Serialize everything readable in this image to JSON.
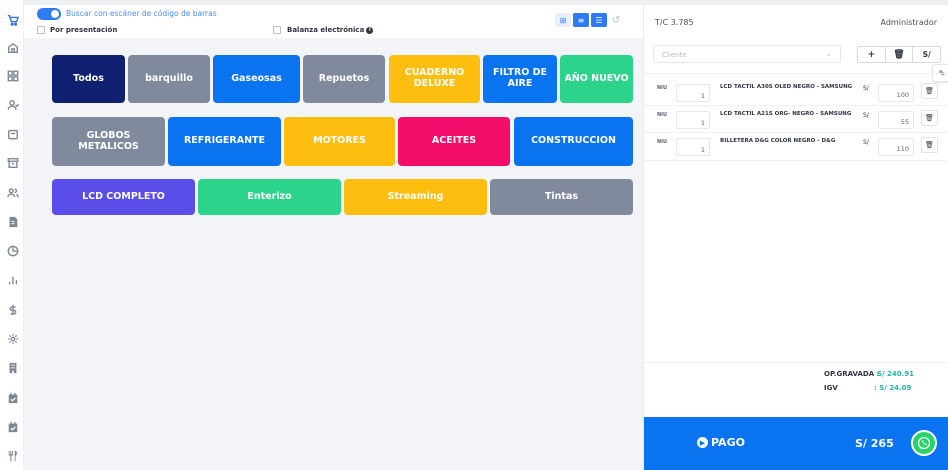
{
  "toolbar": {
    "scanner_label": "Buscar con escáner de código de barras",
    "presentation_label": "Por presentación",
    "scale_label": "Balanza electrónica"
  },
  "categories": [
    {
      "label": "Todos",
      "color": "#0f2070"
    },
    {
      "label": "barquillo",
      "color": "#808a9c"
    },
    {
      "label": "Gaseosas",
      "color": "#0a74f0"
    },
    {
      "label": "Repuetos",
      "color": "#808a9c"
    },
    {
      "label": "CUADERNO DELUXE",
      "color": "#fdbe10"
    },
    {
      "label": "FILTRO DE AIRE",
      "color": "#0a74f0"
    },
    {
      "label": "AÑO NUEVO",
      "color": "#2bd48a"
    },
    {
      "label": "GLOBOS METALICOS",
      "color": "#808a9c"
    },
    {
      "label": "REFRIGERANTE",
      "color": "#0a74f0"
    },
    {
      "label": "MOTORES",
      "color": "#fdbe10"
    },
    {
      "label": "ACEITES",
      "color": "#f20d6a"
    },
    {
      "label": "CONSTRUCCION",
      "color": "#0a74f0"
    },
    {
      "label": "LCD COMPLETO",
      "color": "#5b4de8"
    },
    {
      "label": "Enterizo",
      "color": "#2bd48a"
    },
    {
      "label": "Streaming",
      "color": "#fdbe10"
    },
    {
      "label": "Tintas",
      "color": "#808a9c"
    }
  ],
  "right": {
    "exchange_rate": "T/C 3.785",
    "user": "Administrador",
    "client_placeholder": "Cliente",
    "buttons": {
      "add": "+",
      "delete": "🗑",
      "currency": "S/"
    },
    "cart": [
      {
        "unit": "NIU",
        "qty": "1",
        "name": "LCD TACTIL A30S OLED NEGRO - SAMSUNG",
        "currency": "S/",
        "price": "100"
      },
      {
        "unit": "NIU",
        "qty": "1",
        "name": "LCD TACTIL A21S ORG- NEGRO - SAMSUNG",
        "currency": "S/",
        "price": "55"
      },
      {
        "unit": "NIU",
        "qty": "1",
        "name": "BILLETERA D&G COLOR NEGRO - D&G",
        "currency": "S/",
        "price": "110"
      }
    ],
    "totals": {
      "gravada_label": "OP.GRAVADA :",
      "gravada_value": "S/ 240.91",
      "igv_label": "IGV",
      "igv_value": ": S/ 24.09"
    },
    "pay": {
      "label": "PAGO",
      "total": "S/ 265"
    }
  },
  "colors": {
    "accent": "#0a74f0",
    "whatsapp": "#25d366",
    "total_teal": "#22b6a5"
  },
  "icons": [
    "cart-icon",
    "home-icon",
    "grid-icon",
    "user-check-icon",
    "bag-icon",
    "archive-icon",
    "users-icon",
    "document-icon",
    "pie-chart-icon",
    "bar-chart-icon",
    "dollar-icon",
    "settings-icon",
    "building-icon",
    "calendar-check-icon",
    "calendar-check-icon",
    "utensils-icon"
  ]
}
